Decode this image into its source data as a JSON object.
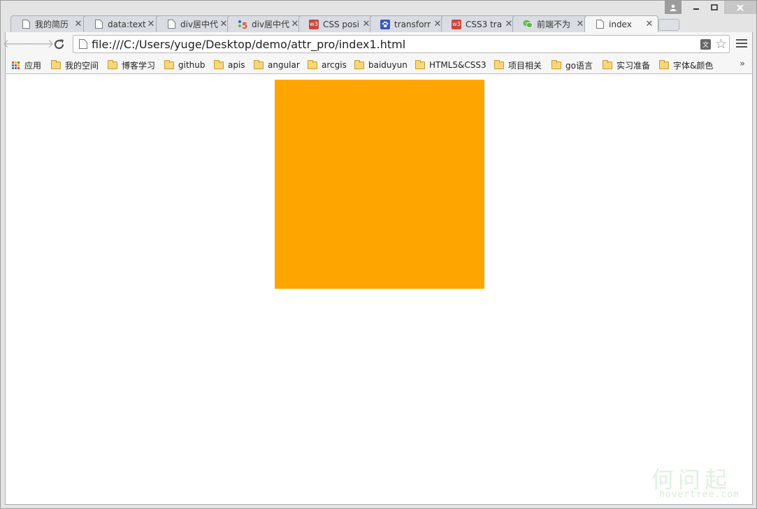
{
  "tabs": [
    {
      "title": "我的简历",
      "favicon": "page-icon"
    },
    {
      "title": "data:text",
      "favicon": "page-icon"
    },
    {
      "title": "div居中代",
      "favicon": "page-icon"
    },
    {
      "title": "div居中代",
      "favicon": "html5-icon"
    },
    {
      "title": "CSS posi",
      "favicon": "w3-icon"
    },
    {
      "title": "transforr",
      "favicon": "paw-icon"
    },
    {
      "title": "CSS3 tra",
      "favicon": "w3-icon"
    },
    {
      "title": "前端不为",
      "favicon": "wechat-icon"
    },
    {
      "title": "index",
      "favicon": "page-icon",
      "active": true
    }
  ],
  "toolbar": {
    "url": "file:///C:/Users/yuge/Desktop/demo/attr_pro/index1.html",
    "translate_glyph": "文"
  },
  "bookmarks": {
    "apps_label": "应用",
    "items": [
      "我的空间",
      "博客学习",
      "github",
      "apis",
      "angular",
      "arcgis",
      "baiduyun",
      "HTML5&CSS3",
      "项目相关",
      "go语言",
      "实习准备",
      "字体&颜色"
    ],
    "overflow": "»"
  },
  "content": {
    "box_color": "#FFA500"
  },
  "watermark": {
    "line1": "何问起",
    "line2": "hovertree.com"
  },
  "colors": {
    "w3": "#c9473c",
    "html5": "#e44d26",
    "paw": "#3a57c4",
    "wechat": "#62b543"
  }
}
